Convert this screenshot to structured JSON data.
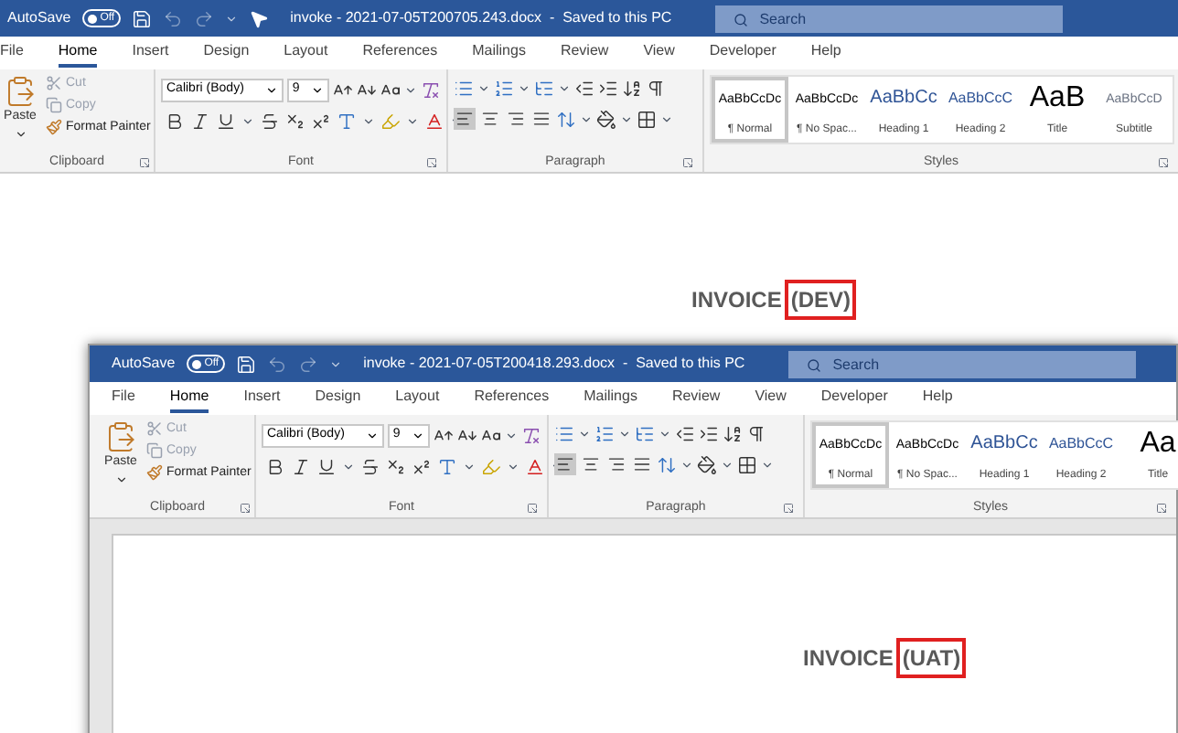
{
  "windows": [
    {
      "autosave": {
        "label": "AutoSave",
        "on": false,
        "state": "Off"
      },
      "title": "invoke - 2021-07-05T200705.243.docx  -  Saved to this PC",
      "mouse_pointer": true,
      "search": {
        "placeholder": "Search"
      },
      "tabs": [
        {
          "label": "File",
          "selected": false
        },
        {
          "label": "Home",
          "selected": true
        },
        {
          "label": "Insert",
          "selected": false
        },
        {
          "label": "Design",
          "selected": false
        },
        {
          "label": "Layout",
          "selected": false
        },
        {
          "label": "References",
          "selected": false
        },
        {
          "label": "Mailings",
          "selected": false
        },
        {
          "label": "Review",
          "selected": false
        },
        {
          "label": "View",
          "selected": false
        },
        {
          "label": "Developer",
          "selected": false
        },
        {
          "label": "Help",
          "selected": false
        }
      ],
      "clipboard": {
        "group": "Clipboard",
        "paste": "Paste",
        "items": [
          {
            "label": "Cut",
            "disabled": true
          },
          {
            "label": "Copy",
            "disabled": true
          },
          {
            "label": "Format Painter",
            "disabled": false
          }
        ]
      },
      "font": {
        "group": "Font",
        "name": "Calibri (Body)",
        "size": "9"
      },
      "paragraph": {
        "group": "Paragraph",
        "alignment": [
          {
            "selected": true
          },
          {
            "selected": false
          },
          {
            "selected": false
          },
          {
            "selected": false
          }
        ]
      },
      "styles": {
        "group": "Styles",
        "items": [
          {
            "kind": "normal",
            "preview": "AaBbCcDc",
            "label": "¶ Normal",
            "selected": true
          },
          {
            "kind": "normal",
            "preview": "AaBbCcDc",
            "label": "¶ No Spac...",
            "selected": false
          },
          {
            "kind": "heading1",
            "preview": "AaBbCc",
            "label": "Heading 1",
            "selected": false
          },
          {
            "kind": "heading2",
            "preview": "AaBbCcC",
            "label": "Heading 2",
            "selected": false
          },
          {
            "kind": "title",
            "preview": "AaB",
            "label": "Title",
            "selected": false
          },
          {
            "kind": "subtitle",
            "preview": "AaBbCcD",
            "label": "Subtitle",
            "selected": false
          }
        ]
      },
      "document": {
        "heading": "INVOICE",
        "tag": "(DEV)"
      }
    },
    {
      "autosave": {
        "label": "AutoSave",
        "on": false,
        "state": "Off"
      },
      "title": "invoke - 2021-07-05T200418.293.docx  -  Saved to this PC",
      "mouse_pointer": false,
      "search": {
        "placeholder": "Search"
      },
      "tabs": [
        {
          "label": "File",
          "selected": false
        },
        {
          "label": "Home",
          "selected": true
        },
        {
          "label": "Insert",
          "selected": false
        },
        {
          "label": "Design",
          "selected": false
        },
        {
          "label": "Layout",
          "selected": false
        },
        {
          "label": "References",
          "selected": false
        },
        {
          "label": "Mailings",
          "selected": false
        },
        {
          "label": "Review",
          "selected": false
        },
        {
          "label": "View",
          "selected": false
        },
        {
          "label": "Developer",
          "selected": false
        },
        {
          "label": "Help",
          "selected": false
        }
      ],
      "clipboard": {
        "group": "Clipboard",
        "paste": "Paste",
        "items": [
          {
            "label": "Cut",
            "disabled": true
          },
          {
            "label": "Copy",
            "disabled": true
          },
          {
            "label": "Format Painter",
            "disabled": false
          }
        ]
      },
      "font": {
        "group": "Font",
        "name": "Calibri (Body)",
        "size": "9"
      },
      "paragraph": {
        "group": "Paragraph",
        "alignment": [
          {
            "selected": true
          },
          {
            "selected": false
          },
          {
            "selected": false
          },
          {
            "selected": false
          }
        ]
      },
      "styles": {
        "group": "Styles",
        "items": [
          {
            "kind": "normal",
            "preview": "AaBbCcDc",
            "label": "¶ Normal",
            "selected": true
          },
          {
            "kind": "normal",
            "preview": "AaBbCcDc",
            "label": "¶ No Spac...",
            "selected": false
          },
          {
            "kind": "heading1",
            "preview": "AaBbCc",
            "label": "Heading 1",
            "selected": false
          },
          {
            "kind": "heading2",
            "preview": "AaBbCcC",
            "label": "Heading 2",
            "selected": false
          },
          {
            "kind": "title",
            "preview": "Aa",
            "label": "Title",
            "selected": false
          }
        ]
      },
      "document": {
        "heading": "INVOICE",
        "tag": "(UAT)"
      }
    }
  ]
}
